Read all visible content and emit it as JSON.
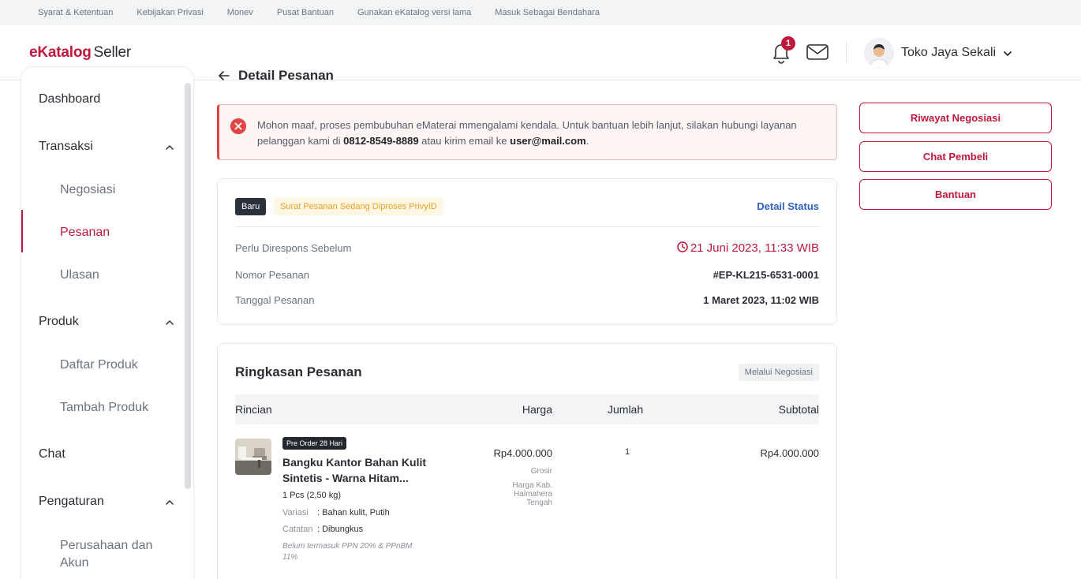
{
  "topbar": {
    "links": [
      "Syarat & Ketentuan",
      "Kebijakan Privasi",
      "Monev",
      "Pusat Bantuan",
      "Gunakan eKatalog versi lama",
      "Masuk Sebagai Bendahara"
    ]
  },
  "header": {
    "logo_main": "eKatalog",
    "logo_sub": "Seller",
    "notification_count": "1",
    "store_name": "Toko Jaya Sekali",
    "icons": [
      "bell-icon",
      "mail-icon",
      "chevron-down-icon"
    ]
  },
  "sidebar": {
    "dashboard": "Dashboard",
    "transaksi": "Transaksi",
    "negosiasi": "Negosiasi",
    "pesanan": "Pesanan",
    "ulasan": "Ulasan",
    "produk": "Produk",
    "daftar_produk": "Daftar Produk",
    "tambah_produk": "Tambah Produk",
    "chat": "Chat",
    "pengaturan": "Pengaturan",
    "perusahaan": "Perusahaan dan Akun",
    "active_item": "Pesanan"
  },
  "page": {
    "title": "Detail Pesanan"
  },
  "alert": {
    "text_before": "Mohon maaf, proses pembubuhan eMaterai mmengalami kendala. Untuk bantuan lebih lanjut, silakan hubungi layanan pelanggan kami di ",
    "phone": "0812-8549-8889",
    "text_middle": " atau kirim email ke ",
    "email": "user@mail.com",
    "text_after": "."
  },
  "status": {
    "badge": "Baru",
    "state": "Surat Pesanan Sedang Diproses PrivyID",
    "detail_link": "Detail Status",
    "deadline_label": "Perlu Direspons Sebelum",
    "deadline_value": "21 Juni 2023, 11:33 WIB",
    "order_no_label": "Nomor Pesanan",
    "order_no_value": "#EP-KL215-6531-0001",
    "order_date_label": "Tanggal Pesanan",
    "order_date_value": "1 Maret 2023, 11:02 WIB"
  },
  "summary": {
    "title": "Ringkasan Pesanan",
    "channel_badge": "Melalui Negosiasi",
    "columns": [
      "Rincian",
      "Harga",
      "Jumlah",
      "Subtotal"
    ],
    "item": {
      "preorder_badge": "Pre Order 28 Hari",
      "name": "Bangku Kantor Bahan Kulit Sintetis - Warna Hitam...",
      "weight": "1 Pcs (2,50 kg)",
      "variant_label": "Variasi",
      "variant_value": ": Bahan kulit, Putih",
      "note_label": "Catatan",
      "note_value": ": Dibungkus",
      "tax_note": "Belum termasuk PPN 20% & PPnBM 11%",
      "price": "Rp4.000.000",
      "price_type": "Grosir",
      "price_region": "Harga Kab. Halmahera Tengah",
      "quantity": "1",
      "subtotal": "Rp4.000.000"
    }
  },
  "actions": {
    "riwayat": "Riwayat Negosiasi",
    "chat": "Chat Pembeli",
    "bantuan": "Bantuan"
  },
  "colors": {
    "brand": "#c0183c",
    "link": "#2e62c4",
    "warning": "#f0a020",
    "error": "#e04646"
  }
}
